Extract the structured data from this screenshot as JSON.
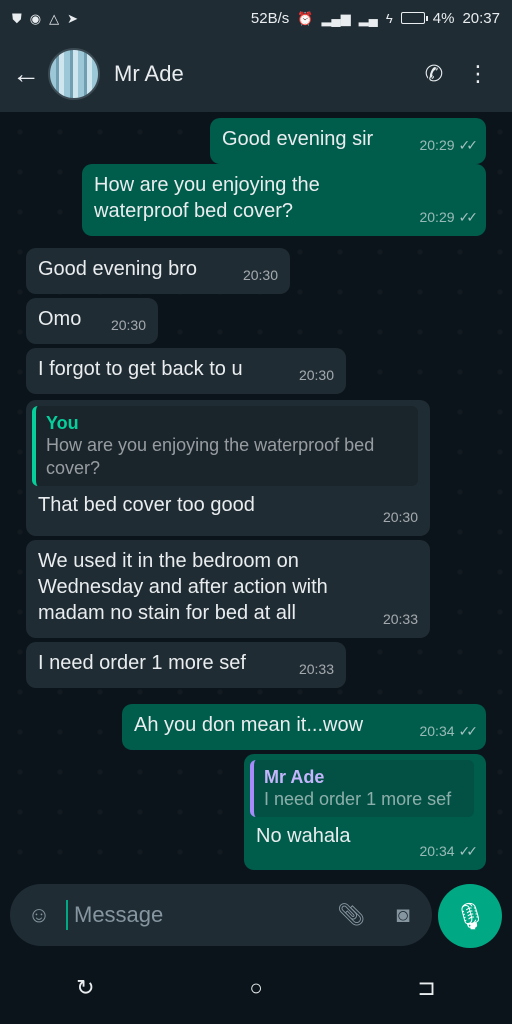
{
  "status_bar": {
    "network_speed": "52B/s",
    "network_type": "LTE",
    "battery": "4%",
    "time": "20:37"
  },
  "header": {
    "back_icon": "arrow-left-icon",
    "contact_name": "Mr Ade",
    "call_icon": "add-call-icon",
    "menu_icon": "kebab-menu-icon"
  },
  "messages": [
    {
      "dir": "out",
      "text": "Good evening sir",
      "time": "20:29",
      "ticks": "✓✓"
    },
    {
      "dir": "out",
      "text": "How are you enjoying the waterproof bed cover?",
      "time": "20:29",
      "ticks": "✓✓"
    },
    {
      "dir": "in",
      "text": "Good evening bro",
      "time": "20:30"
    },
    {
      "dir": "in",
      "text": "Omo",
      "time": "20:30"
    },
    {
      "dir": "in",
      "text": "I forgot to get back to u",
      "time": "20:30"
    },
    {
      "dir": "in",
      "quote_author": "You",
      "quote_text": "How are you enjoying the waterproof bed cover?",
      "text": "That bed cover too good",
      "time": "20:30"
    },
    {
      "dir": "in",
      "text": "We used it in the bedroom on Wednesday and after action with madam no stain for bed at all",
      "time": "20:33"
    },
    {
      "dir": "in",
      "text": "I need order 1 more sef",
      "time": "20:33"
    },
    {
      "dir": "out",
      "text": "Ah you don mean it...wow",
      "time": "20:34",
      "ticks": "✓✓"
    },
    {
      "dir": "out",
      "quote_author": "Mr Ade",
      "quote_text": "I need order 1 more sef",
      "text": "No wahala",
      "time": "20:34",
      "ticks": "✓✓"
    }
  ],
  "composer": {
    "placeholder": "Message",
    "emoji_icon": "sticker-icon",
    "attach_icon": "paperclip-icon",
    "camera_icon": "camera-icon",
    "mic_icon": "microphone-icon"
  }
}
